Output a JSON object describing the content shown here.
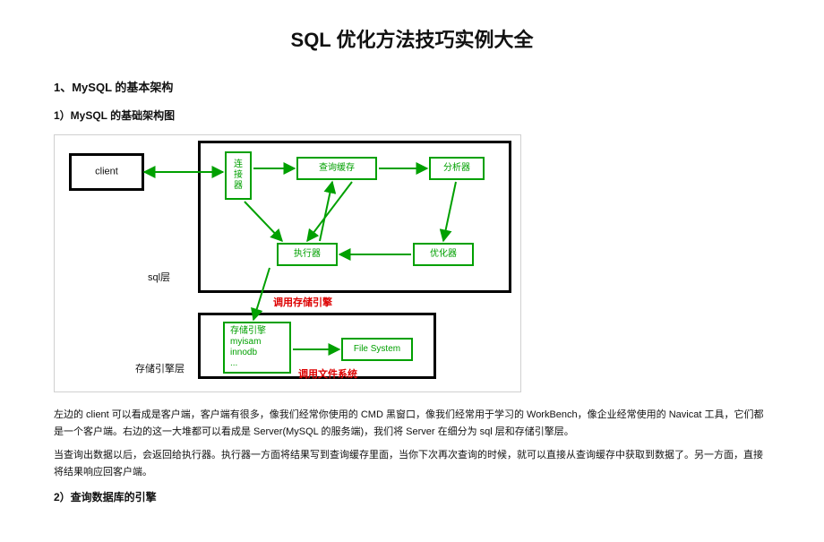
{
  "title": "SQL 优化方法技巧实例大全",
  "section1": {
    "heading": "1、MySQL 的基本架构"
  },
  "sub1": {
    "heading": "1）MySQL 的基础架构图"
  },
  "diagram": {
    "client": "client",
    "layer_sql": "sql层",
    "layer_storage": "存储引擎层",
    "box_conn": "连\n接\n器",
    "box_cache": "查询缓存",
    "box_analyzer": "分析器",
    "box_executor": "执行器",
    "box_optimizer": "优化器",
    "box_engines": "存储引擎\nmyisam\ninnodb\n...",
    "box_fs": "File System",
    "label_call_storage": "调用存储引擎",
    "label_call_fs": "调用文件系统"
  },
  "para1": "左边的 client 可以看成是客户端，客户端有很多，像我们经常你使用的 CMD 黑窗口，像我们经常用于学习的 WorkBench，像企业经常使用的 Navicat 工具，它们都是一个客户端。右边的这一大堆都可以看成是 Server(MySQL 的服务端)，我们将 Server 在细分为 sql 层和存储引擎层。",
  "para2": "当查询出数据以后，会返回给执行器。执行器一方面将结果写到查询缓存里面，当你下次再次查询的时候，就可以直接从查询缓存中获取到数据了。另一方面，直接将结果响应回客户端。",
  "sub2": {
    "heading": "2）查询数据库的引擎"
  }
}
